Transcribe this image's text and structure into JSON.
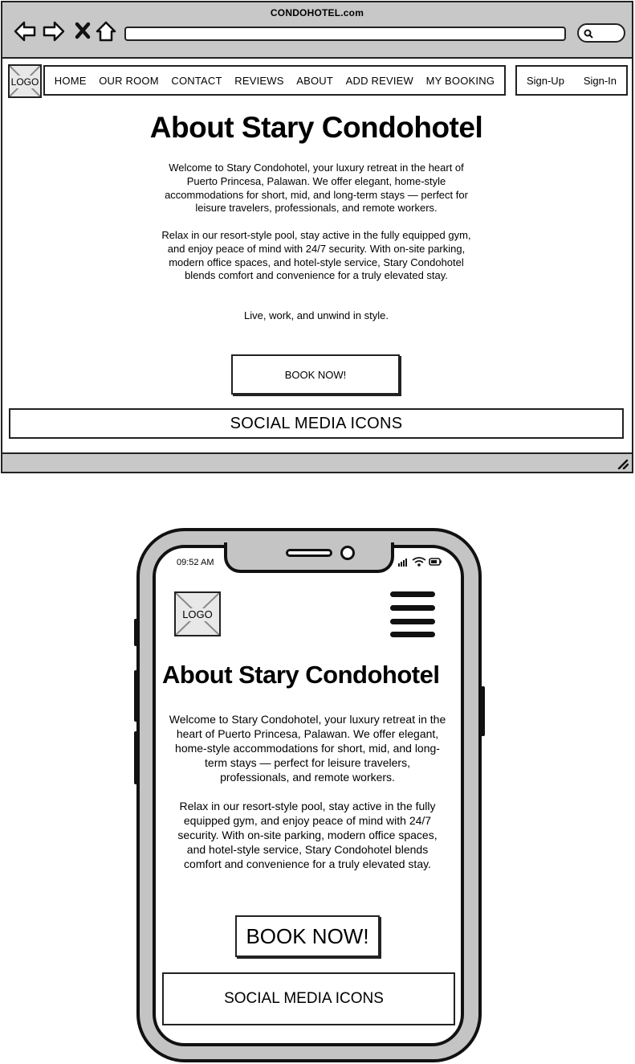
{
  "browser": {
    "title": "CONDOHOTEL.com",
    "nav_icons": [
      "back-arrow-icon",
      "forward-arrow-icon",
      "close-x-icon",
      "home-icon"
    ],
    "search_icon": "search-icon"
  },
  "desktop": {
    "logo": "LOGO",
    "nav": [
      "HOME",
      "OUR ROOM",
      "CONTACT",
      "REVIEWS",
      "ABOUT",
      "ADD REVIEW",
      "MY BOOKING"
    ],
    "auth": [
      "Sign-Up",
      "Sign-In"
    ],
    "title": "About Stary Condohotel",
    "paragraph1": "Welcome to Stary Condohotel, your luxury retreat in the heart of Puerto Princesa, Palawan. We offer elegant, home-style accommodations for short, mid, and long-term stays — perfect for leisure travelers, professionals, and remote workers.",
    "paragraph2": "Relax in our resort-style pool, stay active in the fully equipped gym, and enjoy peace of mind with 24/7 security. With on-site parking, modern office spaces, and hotel-style service, Stary Condohotel blends comfort and convenience for a truly elevated stay.",
    "paragraph3": "Live, work, and unwind in style.",
    "book_button": "BOOK NOW!",
    "social": "SOCIAL MEDIA ICONS"
  },
  "mobile": {
    "time": "09:52 AM",
    "status_icons": [
      "signal-icon",
      "wifi-icon",
      "battery-icon"
    ],
    "logo": "LOGO",
    "menu_icon": "hamburger-menu-icon",
    "title": "About Stary Condohotel",
    "paragraph1": "Welcome to Stary Condohotel, your luxury retreat in the heart of Puerto Princesa, Palawan. We offer elegant, home-style accommodations for short, mid, and long-term stays — perfect for leisure travelers, professionals, and remote workers.",
    "paragraph2": "Relax in our resort-style pool, stay active in the fully equipped gym, and enjoy peace of mind with 24/7 security. With on-site parking, modern office spaces, and hotel-style service, Stary Condohotel blends comfort and convenience for a truly elevated stay.",
    "book_button": "BOOK NOW!",
    "social": "SOCIAL MEDIA ICONS"
  },
  "colors": {
    "chrome_gray": "#c8c8c8",
    "phone_gray": "#c4c4c4",
    "ink": "#222222"
  }
}
